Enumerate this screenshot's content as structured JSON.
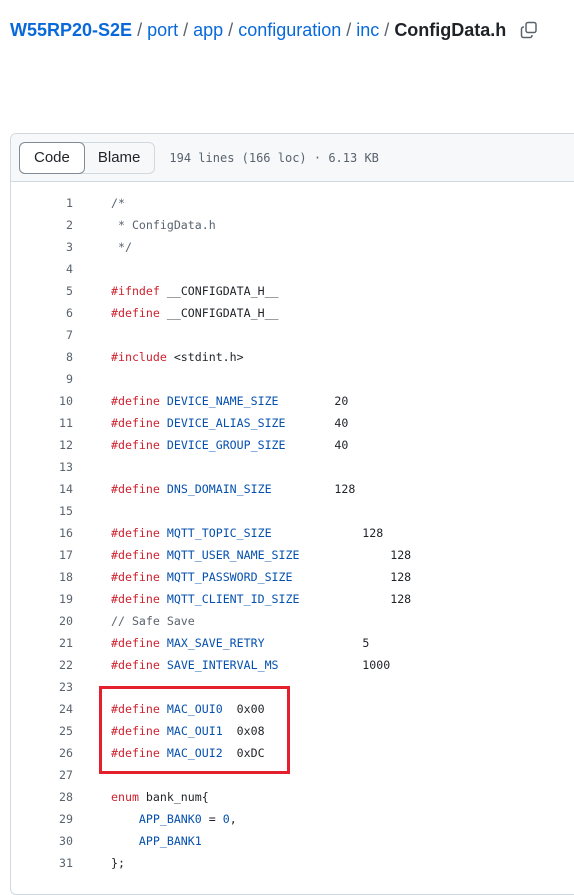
{
  "breadcrumb": {
    "repo": "W55RP20-S2E",
    "dirs": [
      "port",
      "app",
      "configuration",
      "inc"
    ],
    "file": "ConfigData.h",
    "separator": "/"
  },
  "file_header": {
    "tabs": [
      "Code",
      "Blame"
    ],
    "active_tab": "Code",
    "info": "194 lines (166 loc) · 6.13 KB"
  },
  "code_lines": [
    {
      "n": "1",
      "segs": [
        {
          "t": "/*",
          "c": "cm"
        }
      ]
    },
    {
      "n": "2",
      "segs": [
        {
          "t": " * ConfigData.h",
          "c": "cm"
        }
      ]
    },
    {
      "n": "3",
      "segs": [
        {
          "t": " */",
          "c": "cm"
        }
      ]
    },
    {
      "n": "4",
      "segs": []
    },
    {
      "n": "5",
      "segs": [
        {
          "t": "#ifndef",
          "c": "kw"
        },
        {
          "t": " __CONFIGDATA_H__",
          "c": ""
        }
      ]
    },
    {
      "n": "6",
      "segs": [
        {
          "t": "#define",
          "c": "kw"
        },
        {
          "t": " __CONFIGDATA_H__",
          "c": ""
        }
      ]
    },
    {
      "n": "7",
      "segs": []
    },
    {
      "n": "8",
      "segs": [
        {
          "t": "#include",
          "c": "kw"
        },
        {
          "t": " <stdint.h>",
          "c": ""
        }
      ]
    },
    {
      "n": "9",
      "segs": []
    },
    {
      "n": "10",
      "segs": [
        {
          "t": "#define",
          "c": "kw"
        },
        {
          "t": " ",
          "c": ""
        },
        {
          "t": "DEVICE_NAME_SIZE",
          "c": "mac"
        },
        {
          "t": "        20",
          "c": ""
        }
      ]
    },
    {
      "n": "11",
      "segs": [
        {
          "t": "#define",
          "c": "kw"
        },
        {
          "t": " ",
          "c": ""
        },
        {
          "t": "DEVICE_ALIAS_SIZE",
          "c": "mac"
        },
        {
          "t": "       40",
          "c": ""
        }
      ]
    },
    {
      "n": "12",
      "segs": [
        {
          "t": "#define",
          "c": "kw"
        },
        {
          "t": " ",
          "c": ""
        },
        {
          "t": "DEVICE_GROUP_SIZE",
          "c": "mac"
        },
        {
          "t": "       40",
          "c": ""
        }
      ]
    },
    {
      "n": "13",
      "segs": []
    },
    {
      "n": "14",
      "segs": [
        {
          "t": "#define",
          "c": "kw"
        },
        {
          "t": " ",
          "c": ""
        },
        {
          "t": "DNS_DOMAIN_SIZE",
          "c": "mac"
        },
        {
          "t": "         128",
          "c": ""
        }
      ]
    },
    {
      "n": "15",
      "segs": []
    },
    {
      "n": "16",
      "segs": [
        {
          "t": "#define",
          "c": "kw"
        },
        {
          "t": " ",
          "c": ""
        },
        {
          "t": "MQTT_TOPIC_SIZE",
          "c": "mac"
        },
        {
          "t": "             128",
          "c": ""
        }
      ]
    },
    {
      "n": "17",
      "segs": [
        {
          "t": "#define",
          "c": "kw"
        },
        {
          "t": " ",
          "c": ""
        },
        {
          "t": "MQTT_USER_NAME_SIZE",
          "c": "mac"
        },
        {
          "t": "             128",
          "c": ""
        }
      ]
    },
    {
      "n": "18",
      "segs": [
        {
          "t": "#define",
          "c": "kw"
        },
        {
          "t": " ",
          "c": ""
        },
        {
          "t": "MQTT_PASSWORD_SIZE",
          "c": "mac"
        },
        {
          "t": "              128",
          "c": ""
        }
      ]
    },
    {
      "n": "19",
      "segs": [
        {
          "t": "#define",
          "c": "kw"
        },
        {
          "t": " ",
          "c": ""
        },
        {
          "t": "MQTT_CLIENT_ID_SIZE",
          "c": "mac"
        },
        {
          "t": "             128",
          "c": ""
        }
      ]
    },
    {
      "n": "20",
      "segs": [
        {
          "t": "// Safe Save",
          "c": "cm"
        }
      ]
    },
    {
      "n": "21",
      "segs": [
        {
          "t": "#define",
          "c": "kw"
        },
        {
          "t": " ",
          "c": ""
        },
        {
          "t": "MAX_SAVE_RETRY",
          "c": "mac"
        },
        {
          "t": "              5",
          "c": ""
        }
      ]
    },
    {
      "n": "22",
      "segs": [
        {
          "t": "#define",
          "c": "kw"
        },
        {
          "t": " ",
          "c": ""
        },
        {
          "t": "SAVE_INTERVAL_MS",
          "c": "mac"
        },
        {
          "t": "            1000",
          "c": ""
        }
      ]
    },
    {
      "n": "23",
      "segs": []
    },
    {
      "n": "24",
      "segs": [
        {
          "t": "#define",
          "c": "kw"
        },
        {
          "t": " ",
          "c": ""
        },
        {
          "t": "MAC_OUI0",
          "c": "mac"
        },
        {
          "t": "  0x00",
          "c": ""
        }
      ]
    },
    {
      "n": "25",
      "segs": [
        {
          "t": "#define",
          "c": "kw"
        },
        {
          "t": " ",
          "c": ""
        },
        {
          "t": "MAC_OUI1",
          "c": "mac"
        },
        {
          "t": "  0x08",
          "c": ""
        }
      ]
    },
    {
      "n": "26",
      "segs": [
        {
          "t": "#define",
          "c": "kw"
        },
        {
          "t": " ",
          "c": ""
        },
        {
          "t": "MAC_OUI2",
          "c": "mac"
        },
        {
          "t": "  0xDC",
          "c": ""
        }
      ]
    },
    {
      "n": "27",
      "segs": []
    },
    {
      "n": "28",
      "segs": [
        {
          "t": "enum",
          "c": "kw"
        },
        {
          "t": " bank_num{",
          "c": ""
        }
      ]
    },
    {
      "n": "29",
      "segs": [
        {
          "t": "    ",
          "c": ""
        },
        {
          "t": "APP_BANK0",
          "c": "ty"
        },
        {
          "t": " = ",
          "c": ""
        },
        {
          "t": "0",
          "c": "ty"
        },
        {
          "t": ",",
          "c": ""
        }
      ]
    },
    {
      "n": "30",
      "segs": [
        {
          "t": "    ",
          "c": ""
        },
        {
          "t": "APP_BANK1",
          "c": "ty"
        }
      ]
    },
    {
      "n": "31",
      "segs": [
        {
          "t": "};",
          "c": ""
        }
      ]
    }
  ],
  "highlight": {
    "color": "#e3202b",
    "lines": [
      "24",
      "26"
    ]
  },
  "icons": {
    "copy": "copy-path-icon"
  }
}
